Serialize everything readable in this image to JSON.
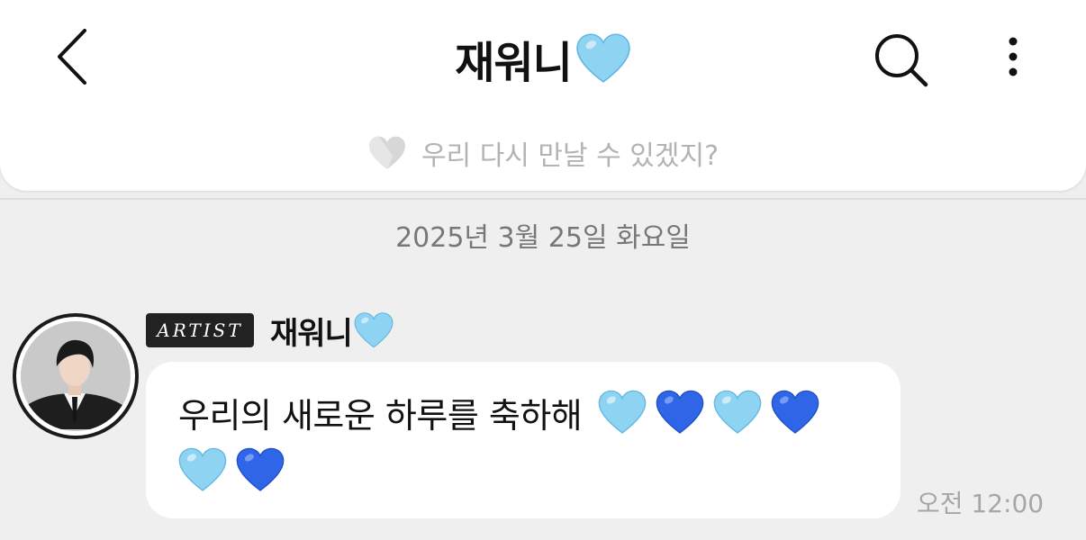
{
  "header": {
    "title": "재워니",
    "title_icon": "light-blue-heart-icon",
    "back_icon": "chevron-left-icon",
    "search_icon": "search-icon",
    "more_icon": "more-vertical-icon",
    "status_text": "우리 다시 만날 수 있겠지?",
    "status_icon": "gray-heart-icon"
  },
  "chat": {
    "date": "2025년 3월 25일 화요일",
    "messages": [
      {
        "badge": "ARTIST",
        "sender": "재워니",
        "text": "우리의 새로운 하루를 축하해",
        "emojis": [
          "light-blue-heart",
          "blue-heart",
          "light-blue-heart",
          "blue-heart",
          "light-blue-heart",
          "blue-heart"
        ],
        "time": "오전 12:00"
      }
    ]
  },
  "colors": {
    "light_blue_heart": "#8fd3f2",
    "blue_heart": "#2f66e8",
    "background": "#efefef",
    "bubble": "#ffffff"
  }
}
